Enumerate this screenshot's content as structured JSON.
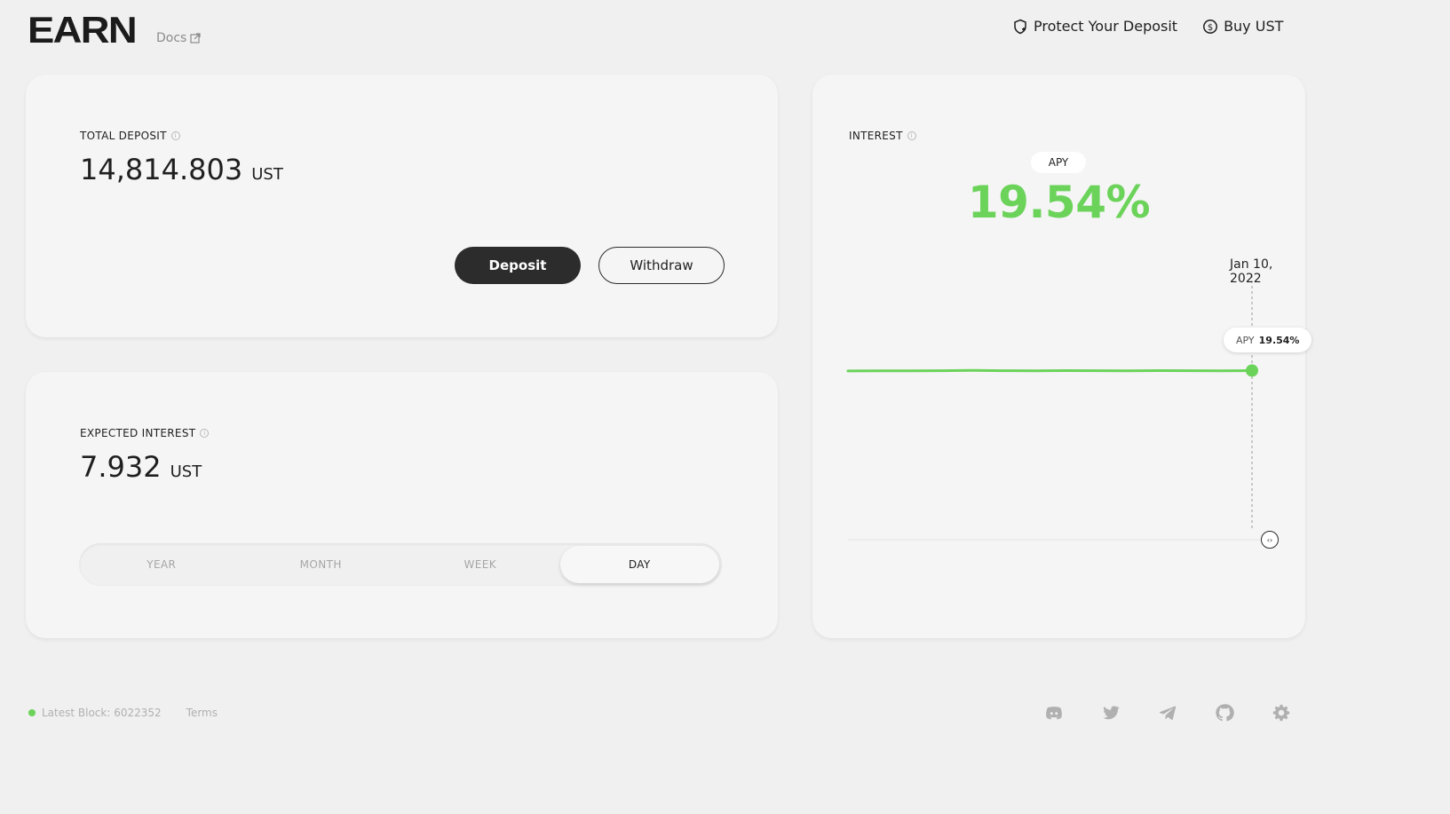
{
  "header": {
    "logo": "EARN",
    "docs_label": "Docs",
    "nav": {
      "protect_label": "Protect Your Deposit",
      "buy_label": "Buy UST"
    }
  },
  "total_deposit": {
    "label": "TOTAL DEPOSIT",
    "value": "14,814.803",
    "unit": "UST",
    "deposit_label": "Deposit",
    "withdraw_label": "Withdraw"
  },
  "expected_interest": {
    "label": "EXPECTED INTEREST",
    "value": "7.932",
    "unit": "UST",
    "periods": [
      "YEAR",
      "MONTH",
      "WEEK",
      "DAY"
    ],
    "active_period": "DAY"
  },
  "interest": {
    "label": "INTEREST",
    "apy_pill": "APY",
    "apy_value": "19.54%",
    "date": "Jan 10, 2022",
    "tooltip_label": "APY",
    "tooltip_value": "19.54%"
  },
  "chart_data": {
    "type": "line",
    "series": [
      {
        "values": [
          19.5,
          19.52,
          19.51,
          19.53,
          19.56,
          19.53,
          19.52,
          19.54,
          19.53,
          19.51,
          19.54,
          19.53,
          19.52,
          19.54
        ]
      }
    ],
    "ylim": [
      0,
      40
    ],
    "highlight": {
      "date": "Jan 10, 2022",
      "value": 19.54
    },
    "line_color": "#6bd35a"
  },
  "footer": {
    "latest_block": "Latest Block: 6022352",
    "terms": "Terms"
  },
  "colors": {
    "accent_green": "#6bd35a",
    "dark": "#2c2c2c"
  }
}
